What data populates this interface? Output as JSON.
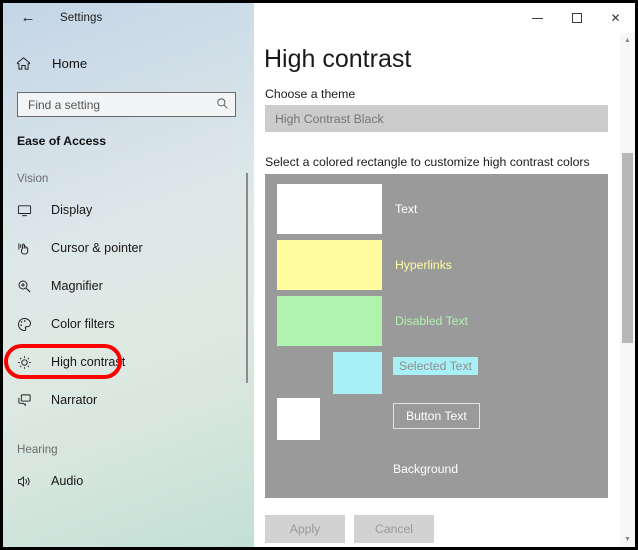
{
  "window": {
    "back_icon": "back-arrow-icon",
    "app_title": "Settings",
    "minimize_label": "Minimize",
    "maximize_label": "Maximize",
    "close_label": "Close",
    "close_glyph": "✕",
    "back_glyph": "←"
  },
  "sidebar": {
    "home": {
      "label": "Home",
      "icon": "home-icon"
    },
    "search": {
      "placeholder": "Find a setting",
      "value": "",
      "icon": "search-icon",
      "icon_glyph": "⚲"
    },
    "group_title": "Ease of Access",
    "sections": [
      {
        "label": "Vision",
        "items": [
          {
            "label": "Display",
            "icon": "monitor-icon",
            "selected": false
          },
          {
            "label": "Cursor & pointer",
            "icon": "cursor-pointer-icon",
            "selected": false
          },
          {
            "label": "Magnifier",
            "icon": "magnifier-icon",
            "selected": false
          },
          {
            "label": "Color filters",
            "icon": "color-palette-icon",
            "selected": false
          },
          {
            "label": "High contrast",
            "icon": "brightness-icon",
            "selected": true,
            "annotated": true
          },
          {
            "label": "Narrator",
            "icon": "narrator-icon",
            "selected": false
          }
        ]
      },
      {
        "label": "Hearing",
        "items": [
          {
            "label": "Audio",
            "icon": "speaker-icon",
            "selected": false
          }
        ]
      }
    ],
    "annotation_color": "#fc0000"
  },
  "main": {
    "page_title": "High contrast",
    "theme_label": "Choose a theme",
    "theme_value": "High Contrast Black",
    "select_label": "Select a colored rectangle to customize high contrast colors",
    "preview_background": "#9a9a9a",
    "rows": [
      {
        "name": "Text",
        "swatch_color": "#ffffff",
        "label_color": "#ffffff"
      },
      {
        "name": "Hyperlinks",
        "swatch_color": "#fffca0",
        "label_color": "#fffca0"
      },
      {
        "name": "Disabled Text",
        "swatch_color": "#aff3af",
        "label_color": "#aff3af"
      },
      {
        "name": "Selected Text",
        "swatch_color": "#a8f0f5",
        "label_color": "#8e8e8e"
      },
      {
        "name": "Button Text",
        "swatch_color": "#ffffff",
        "label_color": "#ffffff"
      },
      {
        "name": "Background",
        "swatch_color": "#9a9a9a",
        "label_color": "#ffffff"
      }
    ],
    "apply_label": "Apply",
    "cancel_label": "Cancel"
  }
}
